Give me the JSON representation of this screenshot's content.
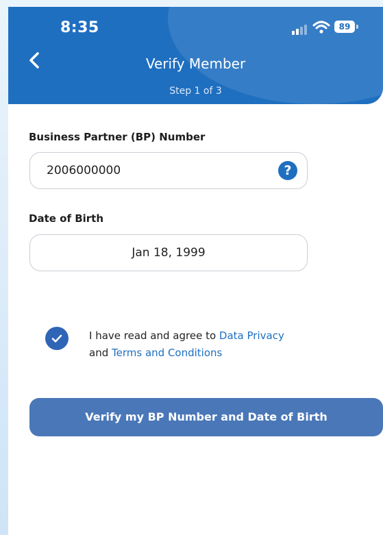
{
  "status_bar": {
    "time": "8:35",
    "battery": "89"
  },
  "header": {
    "title": "Verify Member",
    "step": "Step 1 of 3"
  },
  "form": {
    "bp_label": "Business Partner (BP) Number",
    "bp_value": "2006000000",
    "help_symbol": "?",
    "dob_label": "Date of Birth",
    "dob_value": "Jan 18, 1999"
  },
  "agreement": {
    "checked": true,
    "text_before": "I have read and agree to",
    "privacy_link": "Data Privacy",
    "and_text": "and",
    "terms_link": "Terms and Conditions"
  },
  "cta": {
    "label": "Verify my BP Number and Date of Birth"
  },
  "colors": {
    "primary": "#1f6fc0",
    "button": "#4a77b8",
    "checkbox": "#2f65b6"
  }
}
